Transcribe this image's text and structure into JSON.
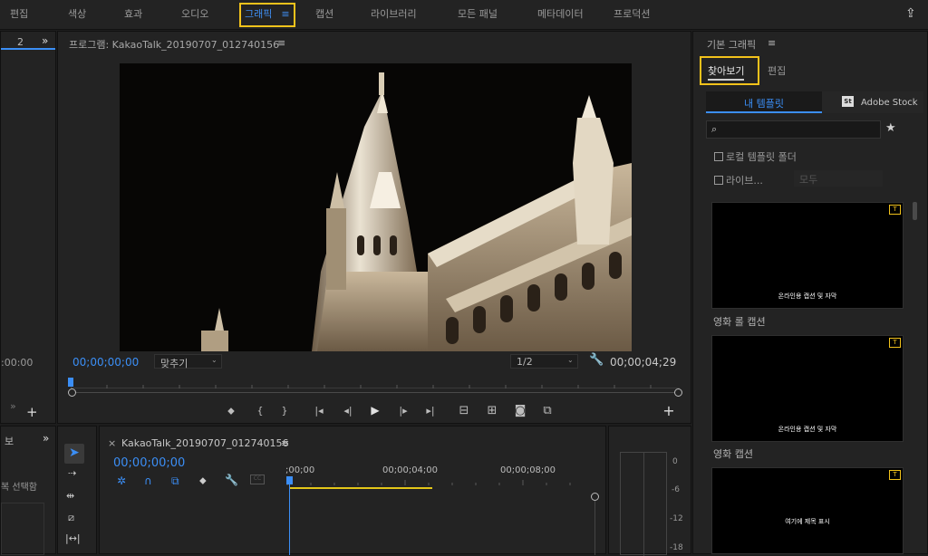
{
  "workspaces": [
    "편집",
    "색상",
    "효과",
    "오디오",
    "그래픽",
    "캡션",
    "라이브러리",
    "모든 패널",
    "메타데이터",
    "프로덕션"
  ],
  "workspace_menu_glyph": "≡",
  "left_panel": {
    "tab": "2",
    "expand": "»",
    "timecode": ":00:00",
    "expand2": "»",
    "add": "+"
  },
  "program": {
    "title": "프로그램: KakaoTalk_20190707_012740156",
    "menu": "≡",
    "timecode_in": "00;00;00;00",
    "fit": "맞추기",
    "quality": "1/2",
    "duration": "00;00;04;29",
    "controls": [
      "marker",
      "in",
      "out",
      "go-in",
      "step-back",
      "play",
      "step-fwd",
      "go-out",
      "lift",
      "extract",
      "export-frame",
      "compare"
    ],
    "control_glyphs": [
      "⬥",
      "{",
      "}",
      "|◂",
      "◂|",
      "▶",
      "|▸",
      "▸|",
      "⊟",
      "⊞",
      "◙",
      "⧉"
    ],
    "add": "+"
  },
  "graphics": {
    "title": "기본 그래픽",
    "menu": "≡",
    "tab_browse": "찾아보기",
    "tab_edit": "편집",
    "my_templates": "내 템플릿",
    "adobe_stock": "Adobe Stock",
    "stock_badge": "St",
    "search_placeholder": "",
    "star": "★",
    "local_folder": "로컬 템플릿 폴더",
    "libraries": "라이브...",
    "library_select": "모두",
    "templates": [
      {
        "label": "",
        "caption": "온라인용 캡션 및 자막"
      },
      {
        "label": "영화 롤 캡션",
        "caption": "온라인용 캡션 및 자막"
      },
      {
        "label": "영화 캡션",
        "caption": "여기에 제목 표시"
      }
    ],
    "badge": "T"
  },
  "lower_left": {
    "tab": "보",
    "expand": "»",
    "label": "복 선택함"
  },
  "timeline": {
    "close": "×",
    "title": "KakaoTalk_20190707_012740156",
    "menu": "≡",
    "timecode": "00;00;00;00",
    "ruler": [
      ";00;00",
      "00;00;04;00",
      "00;00;08;00"
    ]
  },
  "meter": {
    "labels": [
      "0",
      "-6",
      "-12",
      "-18"
    ]
  },
  "share_icon": "⇪",
  "colors": {
    "accent": "#3b8ef5",
    "highlight": "#f2c21b",
    "playhead_bar": "#e3c619"
  }
}
